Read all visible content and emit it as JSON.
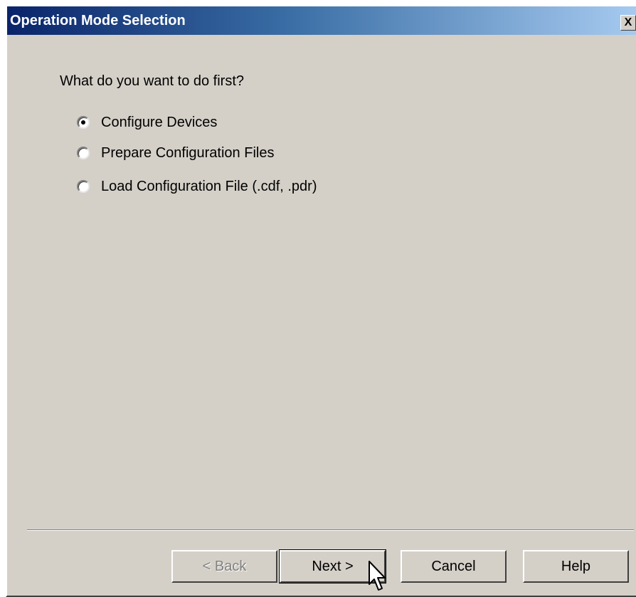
{
  "window": {
    "title": "Operation Mode Selection",
    "close_label": "X"
  },
  "prompt": "What do you want to do first?",
  "options": [
    {
      "label": "Configure Devices",
      "selected": true
    },
    {
      "label": "Prepare Configuration Files",
      "selected": false
    },
    {
      "label": "Load Configuration File (.cdf, .pdr)",
      "selected": false
    }
  ],
  "buttons": {
    "back": "< Back",
    "next": "Next >",
    "cancel": "Cancel",
    "help": "Help"
  },
  "icons": {
    "close": "close-icon",
    "cursor": "mouse-pointer-icon"
  },
  "colors": {
    "title_bar_start": "#0a246a",
    "title_bar_end": "#a6caf0",
    "dialog_background": "#d4d0c8"
  }
}
